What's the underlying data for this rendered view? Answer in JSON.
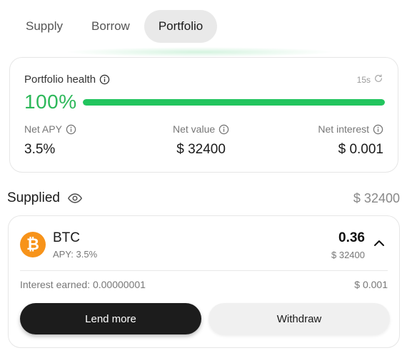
{
  "tabs": [
    {
      "label": "Supply"
    },
    {
      "label": "Borrow"
    },
    {
      "label": "Portfolio"
    }
  ],
  "active_tab": "Portfolio",
  "health": {
    "title": "Portfolio health",
    "refresh_label": "15s",
    "percent_label": "100%",
    "percent_value": 100,
    "bar_color": "#22c55e",
    "percent_color": "#2db85a"
  },
  "stats": {
    "net_apy": {
      "label": "Net APY",
      "value": "3.5%"
    },
    "net_value": {
      "label": "Net value",
      "value": "$ 32400"
    },
    "net_interest": {
      "label": "Net interest",
      "value": "$ 0.001"
    }
  },
  "supplied": {
    "title": "Supplied",
    "total": "$ 32400",
    "asset": {
      "icon": "bitcoin-icon",
      "icon_glyph": "₿",
      "icon_color": "#f7931a",
      "name": "BTC",
      "apy": "APY: 3.5%",
      "amount": "0.36",
      "usd_value": "$ 32400",
      "interest_label": "Interest earned: 0.00000001",
      "interest_value": "$ 0.001",
      "lend_more_label": "Lend more",
      "withdraw_label": "Withdraw"
    }
  }
}
